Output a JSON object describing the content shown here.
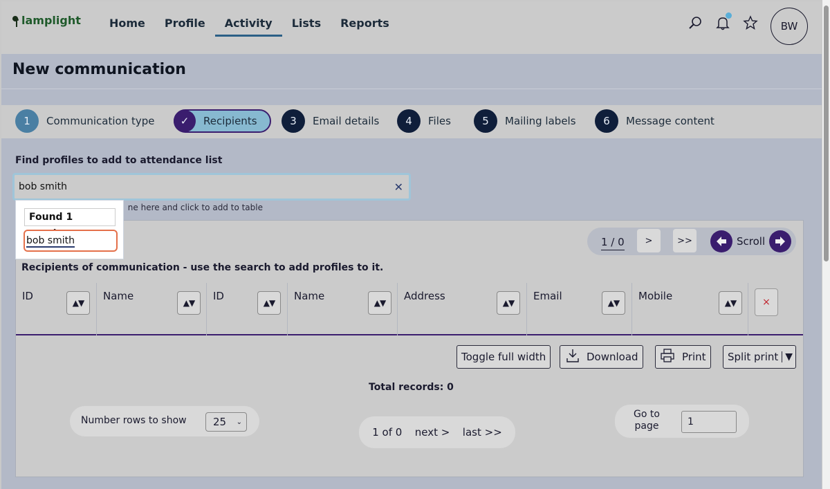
{
  "app": {
    "logo_text": "lamplight"
  },
  "nav": {
    "items": [
      "Home",
      "Profile",
      "Activity",
      "Lists",
      "Reports"
    ],
    "active": "Activity"
  },
  "user": {
    "initials": "BW"
  },
  "page": {
    "title": "New communication"
  },
  "steps": [
    {
      "num": "1",
      "label": "Communication type"
    },
    {
      "num": "✓",
      "label": "Recipients"
    },
    {
      "num": "3",
      "label": "Email details"
    },
    {
      "num": "4",
      "label": "Files"
    },
    {
      "num": "5",
      "label": "Mailing labels"
    },
    {
      "num": "6",
      "label": "Message content"
    }
  ],
  "search": {
    "label": "Find profiles to add to attendance list",
    "value": "bob smith",
    "hint": "ne here and click to add to table"
  },
  "dropdown": {
    "header": "Found 1 results.",
    "result": "bob smith"
  },
  "table": {
    "pager_text": "1 / 0",
    "next_btn": ">",
    "last_btn": ">>",
    "scroll_label": "Scroll",
    "caption": "Recipients of communication - use the search to add profiles to it.",
    "columns": [
      "ID",
      "Name",
      "ID",
      "Name",
      "Address",
      "Email",
      "Mobile"
    ],
    "sort_glyph": "▲▼",
    "delete_glyph": "×"
  },
  "actions": {
    "toggle_full_width": "Toggle full width",
    "download": "Download",
    "print": "Print",
    "split_print": "Split print"
  },
  "footer": {
    "total_records": "Total records: 0",
    "rows_label": "Number rows to show",
    "rows_value": "25",
    "page_of": "1 of 0",
    "next": "next >",
    "last": "last >>",
    "goto_label": "Go to page",
    "goto_value": "1"
  },
  "colors": {
    "accent_purple": "#3a1d6e",
    "step_dark": "#0f1e3a",
    "highlight_orange": "#e4704a",
    "delete_red": "#c0222c"
  }
}
